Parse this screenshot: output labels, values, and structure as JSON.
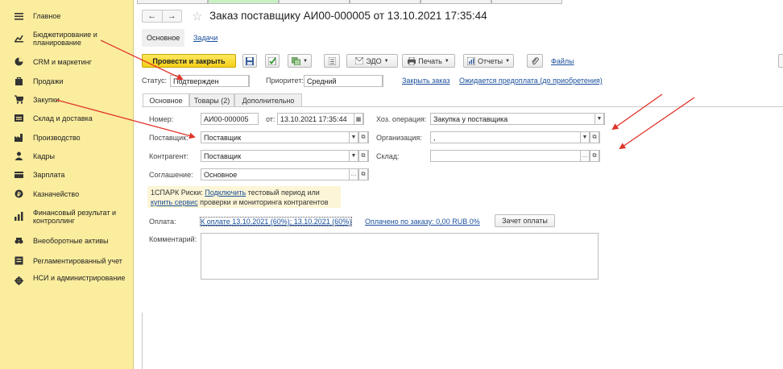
{
  "sidebar": {
    "items": [
      {
        "label": "Главное",
        "icon": "menu-lines-icon"
      },
      {
        "label": "Бюджетирование и планирование",
        "icon": "budget-icon"
      },
      {
        "label": "CRM и маркетинг",
        "icon": "pie-icon"
      },
      {
        "label": "Продажи",
        "icon": "bag-icon"
      },
      {
        "label": "Закупки",
        "icon": "cart-icon"
      },
      {
        "label": "Склад и доставка",
        "icon": "warehouse-icon"
      },
      {
        "label": "Производство",
        "icon": "factory-icon"
      },
      {
        "label": "Кадры",
        "icon": "person-icon"
      },
      {
        "label": "Зарплата",
        "icon": "wallet-icon"
      },
      {
        "label": "Казначейство",
        "icon": "coin-icon"
      },
      {
        "label": "Финансовый результат и контроллинг",
        "icon": "chart-icon"
      },
      {
        "label": "Внеоборотные активы",
        "icon": "assets-icon"
      },
      {
        "label": "Регламентированный учет",
        "icon": "ledger-icon"
      },
      {
        "label": "НСИ и администрирование",
        "icon": "gear-icon"
      }
    ]
  },
  "header": {
    "back": "←",
    "forward": "→",
    "star": "☆",
    "title": "Заказ поставщику АИ00-000005 от 13.10.2021 17:35:44"
  },
  "subtabs": {
    "main": "Основное",
    "tasks": "Задачи"
  },
  "toolbar": {
    "post_close": "Провести и закрыть",
    "edo": "ЭДО",
    "print": "Печать",
    "reports": "Отчеты",
    "files": "Файлы"
  },
  "status_row": {
    "status_label": "Статус:",
    "status_value": "Подтвержден",
    "priority_label": "Приоритет:",
    "priority_value": "Средний",
    "close_order": "Закрыть заказ",
    "awaiting": "Ожидается предоплата (до приобретения)"
  },
  "form_tabs": [
    "Основное",
    "Товары (2)",
    "Дополнительно"
  ],
  "form": {
    "number_label": "Номер:",
    "number_value": "АИ00-000005",
    "date_label": "от:",
    "date_value": "13.10.2021 17:35:44",
    "operation_label": "Хоз. операция:",
    "operation_value": "Закупка у поставщика",
    "supplier_label": "Поставщик:",
    "supplier_value": "Поставщик",
    "org_label": "Организация:",
    "org_value": ",",
    "counterparty_label": "Контрагент:",
    "counterparty_value": "Поставщик",
    "warehouse_label": "Склад:",
    "warehouse_value": "",
    "agreement_label": "Соглашение:",
    "agreement_value": "Основное"
  },
  "spark": {
    "prefix": "1СПАРК Риски:",
    "connect": "Подключить",
    "middle": "тестовый период или",
    "buy": "купить сервис",
    "suffix": "проверки и мониторинга контрагентов"
  },
  "payment": {
    "label": "Оплата:",
    "schedule": "К оплате 13.10.2021 (60%); 13.10.2021 (60%)",
    "paid": "Оплачено по заказу: 0,00 RUB 0%",
    "offset_button": "Зачет оплаты"
  },
  "comment": {
    "label": "Комментарий:",
    "value": ""
  },
  "colors": {
    "sidebar_bg": "#fbed9e",
    "primary_btn": "#f4cf18",
    "link": "#1a4f9c",
    "arrow": "#e0352b"
  }
}
